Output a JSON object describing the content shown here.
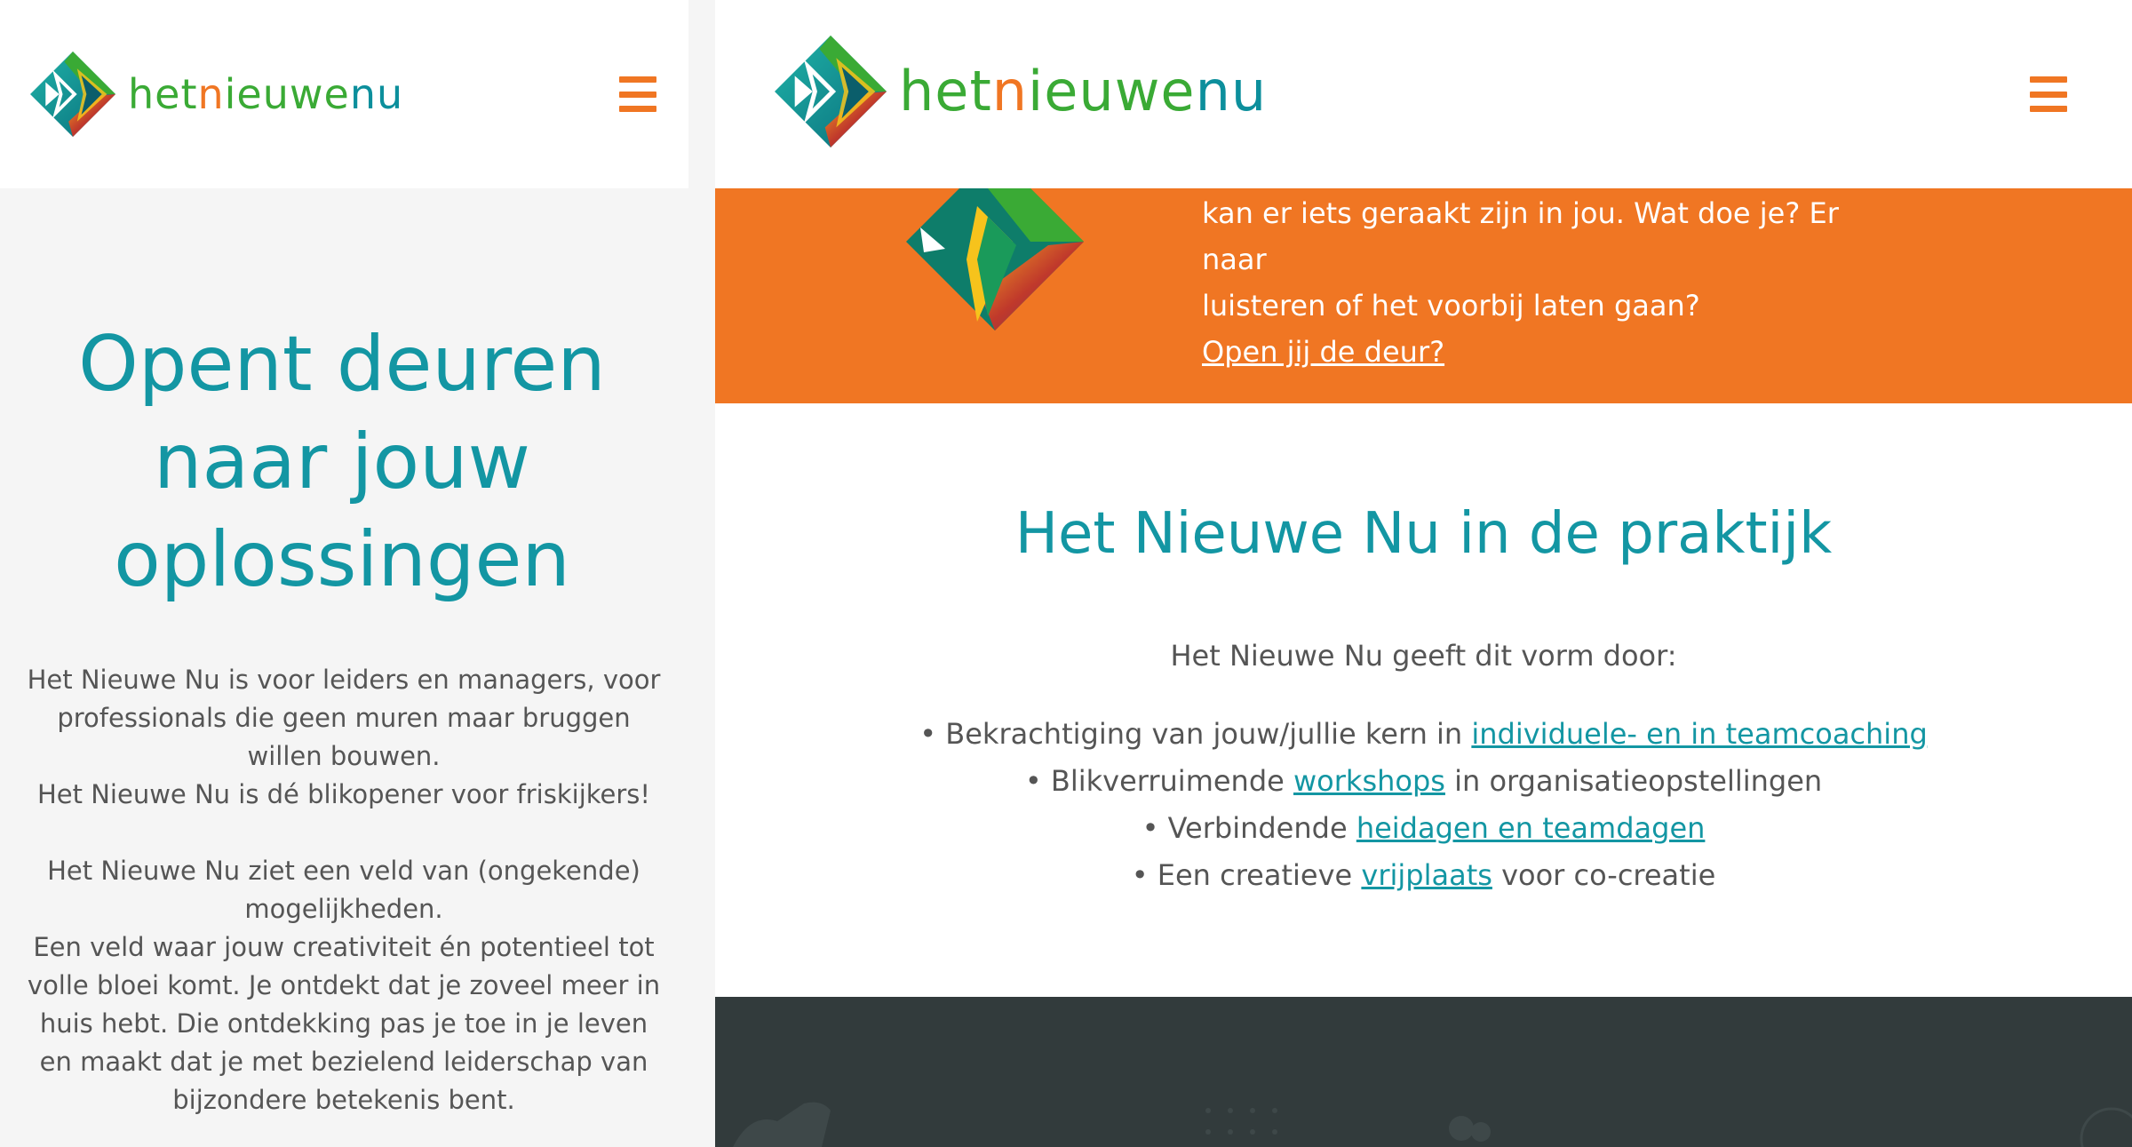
{
  "colors": {
    "accent_teal": "#1396a3",
    "accent_orange": "#f07623",
    "accent_green": "#3aaa35",
    "body_text": "#555555",
    "panel_grey": "#f5f5f5",
    "footer_dark": "#323b3c"
  },
  "brand": {
    "logo_icon": "diamond-arrow-logo-icon",
    "parts": {
      "a": "het",
      "b": "n",
      "c": "ieuwe",
      "d": "nu"
    }
  },
  "menu": {
    "icon": "hamburger-menu-icon"
  },
  "mobile": {
    "hero_title": "Opent deuren naar jouw oplossingen",
    "paragraph1": "Het Nieuwe Nu is voor leiders en managers, voor professionals die geen muren maar bruggen willen bouwen.",
    "paragraph2": "Het Nieuwe Nu is dé blikopener voor friskijkers!",
    "paragraph3": "Het Nieuwe Nu ziet een veld van (ongekende) mogelijkheden.",
    "paragraph4": "Een veld waar jouw creativiteit én potentieel tot volle bloei komt. Je ontdekt dat je zoveel meer in huis hebt. Die ontdekking pas je toe in je leven en maakt dat je met bezielend leiderschap van bijzondere betekenis bent."
  },
  "banner": {
    "line1": "kan er iets geraakt zijn in jou. Wat doe je? Er naar",
    "line2": "luisteren of het voorbij laten gaan?",
    "link": "Open jij de deur?"
  },
  "praktijk": {
    "title": "Het Nieuwe Nu in de praktijk",
    "intro": "Het Nieuwe Nu geeft dit vorm door:",
    "items": [
      {
        "before": "• Bekrachtiging van jouw/jullie kern in ",
        "link": "individuele- en in teamcoaching",
        "after": ""
      },
      {
        "before": "• Blikverruimende ",
        "link": "workshops",
        "after": " in organisatieopstellingen"
      },
      {
        "before": "• Verbindende ",
        "link": "heidagen en teamdagen",
        "after": ""
      },
      {
        "before": "• Een creatieve ",
        "link": "vrijplaats",
        "after": " voor co-creatie"
      }
    ]
  }
}
